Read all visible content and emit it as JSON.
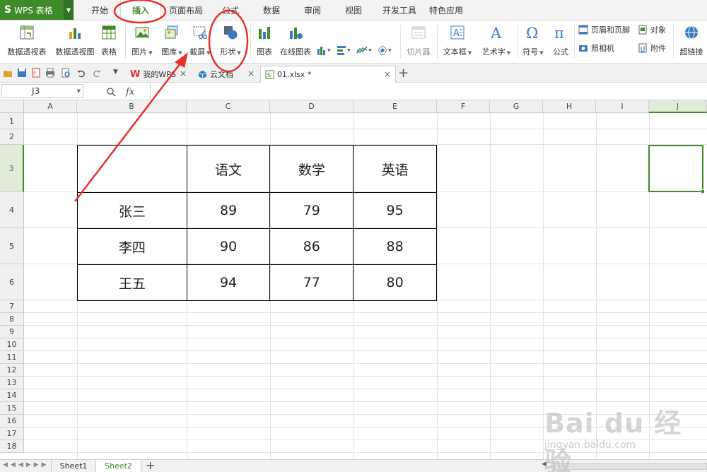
{
  "app": {
    "logo": "S",
    "name": "WPS 表格"
  },
  "menu_tabs": [
    "开始",
    "插入",
    "页面布局",
    "公式",
    "数据",
    "审阅",
    "视图",
    "开发工具",
    "特色应用"
  ],
  "ribbon": {
    "pivot_table": "数据透视表",
    "pivot_chart": "数据透视图",
    "table": "表格",
    "picture": "图片",
    "gallery": "图库",
    "screenshot": "截屏",
    "shape": "形状",
    "chart": "图表",
    "online_chart": "在线图表",
    "slicer": "切片器",
    "textbox": "文本框",
    "wordart": "艺术字",
    "symbol": "符号",
    "formula": "公式",
    "header_footer": "页眉和页脚",
    "object": "对象",
    "camera": "照相机",
    "attachment": "附件",
    "hyperlink": "超链接"
  },
  "doc_tabs": [
    "我的WPS",
    "云文档",
    "01.xlsx *"
  ],
  "formula_bar": {
    "cell_ref": "J3",
    "fx": "fx",
    "value": ""
  },
  "columns": [
    "A",
    "B",
    "C",
    "D",
    "E",
    "F",
    "G",
    "H",
    "I",
    "J"
  ],
  "rows": [
    "1",
    "2",
    "3",
    "4",
    "5",
    "6",
    "7",
    "8",
    "9",
    "10",
    "11",
    "12",
    "13",
    "14",
    "15",
    "16",
    "17",
    "18"
  ],
  "table": {
    "headers": [
      "",
      "语文",
      "数学",
      "英语"
    ],
    "rows": [
      [
        "张三",
        "89",
        "79",
        "95"
      ],
      [
        "李四",
        "90",
        "86",
        "88"
      ],
      [
        "王五",
        "94",
        "77",
        "80"
      ]
    ]
  },
  "sheets": [
    "Sheet1",
    "Sheet2"
  ],
  "watermark": {
    "brand": "Bai du 经验",
    "url": "jingyan.baidu.com"
  },
  "colors": {
    "accent": "#3f8a29",
    "annotation": "#e8302a"
  }
}
